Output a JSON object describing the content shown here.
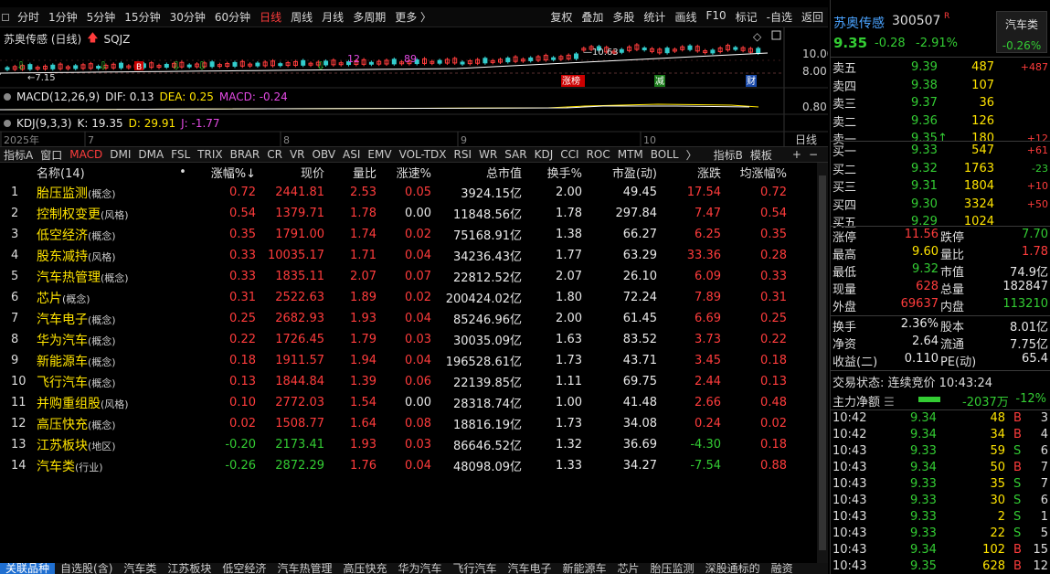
{
  "toolbar": {
    "periods": [
      "分时",
      "1分钟",
      "5分钟",
      "15分钟",
      "30分钟",
      "60分钟",
      "日线",
      "周线",
      "月线",
      "多周期",
      "更多 〉"
    ],
    "active_period": "日线",
    "right": [
      "复权",
      "叠加",
      "多股",
      "统计",
      "画线",
      "F10",
      "标记",
      "-自选",
      "返回"
    ]
  },
  "chart": {
    "title": "苏奥传感 (日线)",
    "indicator": "SQJZ",
    "price_labels": [
      "10.00",
      "8.00"
    ],
    "low_label": "7.15",
    "high_label": "10.63",
    "markers": [
      "12",
      "89"
    ],
    "event_tags": [
      "涨榜",
      "减",
      "财"
    ],
    "b_tag": "B",
    "macd": {
      "name": "MACD(12,26,9)",
      "dif_label": "DIF: 0.13",
      "dea_label": "DEA: 0.25",
      "macd_label": "MACD: -0.24",
      "axis": "0.80"
    },
    "kdj": {
      "name": "KDJ(9,3,3)",
      "k_label": "K: 19.35",
      "d_label": "D: 29.91",
      "j_label": "J: -1.77"
    },
    "time_axis": [
      "2025年",
      "7",
      "8",
      "9",
      "10"
    ],
    "time_right": "日线"
  },
  "indicator_tabs": [
    "指标A",
    "窗口",
    "MACD",
    "DMI",
    "DMA",
    "FSL",
    "TRIX",
    "BRAR",
    "CR",
    "VR",
    "OBV",
    "ASI",
    "EMV",
    "VOL-TDX",
    "RSI",
    "WR",
    "SAR",
    "KDJ",
    "CCI",
    "ROC",
    "MTM",
    "BOLL",
    "〉",
    "指标B",
    "模板",
    "+",
    "−"
  ],
  "active_indicator": "MACD",
  "list": {
    "headers": {
      "name": "名称(14)",
      "dot": "•",
      "pct": "涨幅%↓",
      "price": "现价",
      "lb": "量比",
      "spd": "涨速%",
      "cap": "总市值",
      "turn": "换手%",
      "pe": "市盈(动)",
      "chg": "涨跌",
      "avg": "均涨幅%"
    },
    "rows": [
      {
        "no": "1",
        "name": "胎压监测",
        "tag": "(概念)",
        "pct": "0.72",
        "price": "2441.81",
        "lb": "2.53",
        "spd": "0.05",
        "cap": "3924.15亿",
        "turn": "2.00",
        "pe": "49.45",
        "chg": "17.54",
        "avg": "0.72"
      },
      {
        "no": "2",
        "name": "控制权变更",
        "tag": "(风格)",
        "pct": "0.54",
        "price": "1379.71",
        "lb": "1.78",
        "spd": "0.00",
        "cap": "11848.56亿",
        "turn": "1.78",
        "pe": "297.84",
        "chg": "7.47",
        "avg": "0.54"
      },
      {
        "no": "3",
        "name": "低空经济",
        "tag": "(概念)",
        "pct": "0.35",
        "price": "1791.00",
        "lb": "1.74",
        "spd": "0.02",
        "cap": "75168.91亿",
        "turn": "1.38",
        "pe": "66.27",
        "chg": "6.25",
        "avg": "0.35"
      },
      {
        "no": "4",
        "name": "股东减持",
        "tag": "(风格)",
        "pct": "0.33",
        "price": "10035.17",
        "lb": "1.71",
        "spd": "0.04",
        "cap": "34236.43亿",
        "turn": "1.77",
        "pe": "63.29",
        "chg": "33.36",
        "avg": "0.28"
      },
      {
        "no": "5",
        "name": "汽车热管理",
        "tag": "(概念)",
        "pct": "0.33",
        "price": "1835.11",
        "lb": "2.07",
        "spd": "0.07",
        "cap": "22812.52亿",
        "turn": "2.07",
        "pe": "26.10",
        "chg": "6.09",
        "avg": "0.33"
      },
      {
        "no": "6",
        "name": "芯片",
        "tag": "(概念)",
        "pct": "0.31",
        "price": "2522.63",
        "lb": "1.89",
        "spd": "0.02",
        "cap": "200424.02亿",
        "turn": "1.80",
        "pe": "72.24",
        "chg": "7.89",
        "avg": "0.31"
      },
      {
        "no": "7",
        "name": "汽车电子",
        "tag": "(概念)",
        "pct": "0.25",
        "price": "2682.93",
        "lb": "1.93",
        "spd": "0.04",
        "cap": "85246.96亿",
        "turn": "2.00",
        "pe": "61.45",
        "chg": "6.69",
        "avg": "0.25"
      },
      {
        "no": "8",
        "name": "华为汽车",
        "tag": "(概念)",
        "pct": "0.22",
        "price": "1726.45",
        "lb": "1.79",
        "spd": "0.03",
        "cap": "30035.09亿",
        "turn": "1.63",
        "pe": "83.52",
        "chg": "3.73",
        "avg": "0.22"
      },
      {
        "no": "9",
        "name": "新能源车",
        "tag": "(概念)",
        "pct": "0.18",
        "price": "1911.57",
        "lb": "1.94",
        "spd": "0.04",
        "cap": "196528.61亿",
        "turn": "1.73",
        "pe": "43.71",
        "chg": "3.45",
        "avg": "0.18"
      },
      {
        "no": "10",
        "name": "飞行汽车",
        "tag": "(概念)",
        "pct": "0.13",
        "price": "1844.84",
        "lb": "1.39",
        "spd": "0.06",
        "cap": "22139.85亿",
        "turn": "1.11",
        "pe": "69.75",
        "chg": "2.44",
        "avg": "0.13"
      },
      {
        "no": "11",
        "name": "并购重组股",
        "tag": "(风格)",
        "pct": "0.10",
        "price": "2772.03",
        "lb": "1.54",
        "spd": "0.00",
        "cap": "28318.74亿",
        "turn": "1.00",
        "pe": "41.48",
        "chg": "2.66",
        "avg": "0.48"
      },
      {
        "no": "12",
        "name": "高压快充",
        "tag": "(概念)",
        "pct": "0.02",
        "price": "1508.77",
        "lb": "1.64",
        "spd": "0.08",
        "cap": "18816.19亿",
        "turn": "1.73",
        "pe": "34.08",
        "chg": "0.24",
        "avg": "0.02"
      },
      {
        "no": "13",
        "name": "江苏板块",
        "tag": "(地区)",
        "pct": "-0.20",
        "price": "2173.41",
        "lb": "1.93",
        "spd": "0.03",
        "cap": "86646.52亿",
        "turn": "1.32",
        "pe": "36.69",
        "chg": "-4.30",
        "avg": "0.18"
      },
      {
        "no": "14",
        "name": "汽车类",
        "tag": "(行业)",
        "pct": "-0.26",
        "price": "2872.29",
        "lb": "1.76",
        "spd": "0.04",
        "cap": "48098.09亿",
        "turn": "1.33",
        "pe": "34.27",
        "chg": "-7.54",
        "avg": "0.88"
      }
    ]
  },
  "bottom_tabs": [
    "关联品种",
    "自选股(含)",
    "汽车类",
    "江苏板块",
    "低空经济",
    "汽车热管理",
    "高压快充",
    "华为汽车",
    "飞行汽车",
    "汽车电子",
    "新能源车",
    "芯片",
    "胎压监测",
    "深股通标的",
    "融资"
  ],
  "active_bottom_tab": "关联品种",
  "stock": {
    "name": "苏奥传感",
    "code": "300507",
    "r_mark": "R",
    "price": "9.35",
    "change": "-0.28",
    "pct": "-2.91%",
    "sector_name": "汽车类",
    "sector_pct": "-0.26%"
  },
  "asks": [
    {
      "label": "卖五",
      "price": "9.39",
      "vol": "487",
      "delta": "+487"
    },
    {
      "label": "卖四",
      "price": "9.38",
      "vol": "107",
      "delta": ""
    },
    {
      "label": "卖三",
      "price": "9.37",
      "vol": "36",
      "delta": ""
    },
    {
      "label": "卖二",
      "price": "9.36",
      "vol": "126",
      "delta": ""
    },
    {
      "label": "卖一",
      "price": "9.35↑",
      "vol": "180",
      "delta": "+12"
    }
  ],
  "bids": [
    {
      "label": "买一",
      "price": "9.33",
      "vol": "547",
      "delta": "+61"
    },
    {
      "label": "买二",
      "price": "9.32",
      "vol": "1763",
      "delta": "-23"
    },
    {
      "label": "买三",
      "price": "9.31",
      "vol": "1804",
      "delta": "+10"
    },
    {
      "label": "买四",
      "price": "9.30",
      "vol": "3324",
      "delta": "+50"
    },
    {
      "label": "买五",
      "price": "9.29",
      "vol": "1024",
      "delta": ""
    }
  ],
  "stats1": [
    {
      "k1": "涨停",
      "v1": "11.56",
      "c1": "red",
      "k2": "跌停",
      "v2": "7.70",
      "c2": "green"
    },
    {
      "k1": "最高",
      "v1": "9.60",
      "c1": "yellow",
      "k2": "量比",
      "v2": "1.78",
      "c2": "red"
    },
    {
      "k1": "最低",
      "v1": "9.32",
      "c1": "green",
      "k2": "市值",
      "v2": "74.9亿",
      "c2": "white"
    },
    {
      "k1": "现量",
      "v1": "628",
      "c1": "red",
      "k2": "总量",
      "v2": "182847",
      "c2": "white"
    },
    {
      "k1": "外盘",
      "v1": "69637",
      "c1": "red",
      "k2": "内盘",
      "v2": "113210",
      "c2": "green"
    }
  ],
  "stats2": [
    {
      "k1": "换手",
      "v1": "2.36%",
      "c1": "white",
      "k2": "股本",
      "v2": "8.01亿",
      "c2": "white"
    },
    {
      "k1": "净资",
      "v1": "2.64",
      "c1": "white",
      "k2": "流通",
      "v2": "7.75亿",
      "c2": "white"
    },
    {
      "k1": "收益(二)",
      "v1": "0.110",
      "c1": "white",
      "k2": "PE(动)",
      "v2": "65.4",
      "c2": "white"
    }
  ],
  "trade_state": "交易状态: 连续竞价 10:43:24",
  "flow": {
    "label": "主力净额",
    "value": "-2037万",
    "pct": "-12%"
  },
  "ticks": [
    {
      "t": "10:42",
      "p": "9.34",
      "v": "48",
      "s": "B",
      "n": "3"
    },
    {
      "t": "10:42",
      "p": "9.34",
      "v": "34",
      "s": "B",
      "n": "4"
    },
    {
      "t": "10:43",
      "p": "9.33",
      "v": "59",
      "s": "S",
      "n": "6"
    },
    {
      "t": "10:43",
      "p": "9.34",
      "v": "50",
      "s": "B",
      "n": "7"
    },
    {
      "t": "10:43",
      "p": "9.33",
      "v": "35",
      "s": "S",
      "n": "7"
    },
    {
      "t": "10:43",
      "p": "9.33",
      "v": "30",
      "s": "S",
      "n": "6"
    },
    {
      "t": "10:43",
      "p": "9.33",
      "v": "2",
      "s": "S",
      "n": "1"
    },
    {
      "t": "10:43",
      "p": "9.33",
      "v": "22",
      "s": "S",
      "n": "5"
    },
    {
      "t": "10:43",
      "p": "9.34",
      "v": "102",
      "s": "B",
      "n": "15"
    },
    {
      "t": "10:43",
      "p": "9.35",
      "v": "628",
      "s": "B",
      "n": "12"
    }
  ]
}
